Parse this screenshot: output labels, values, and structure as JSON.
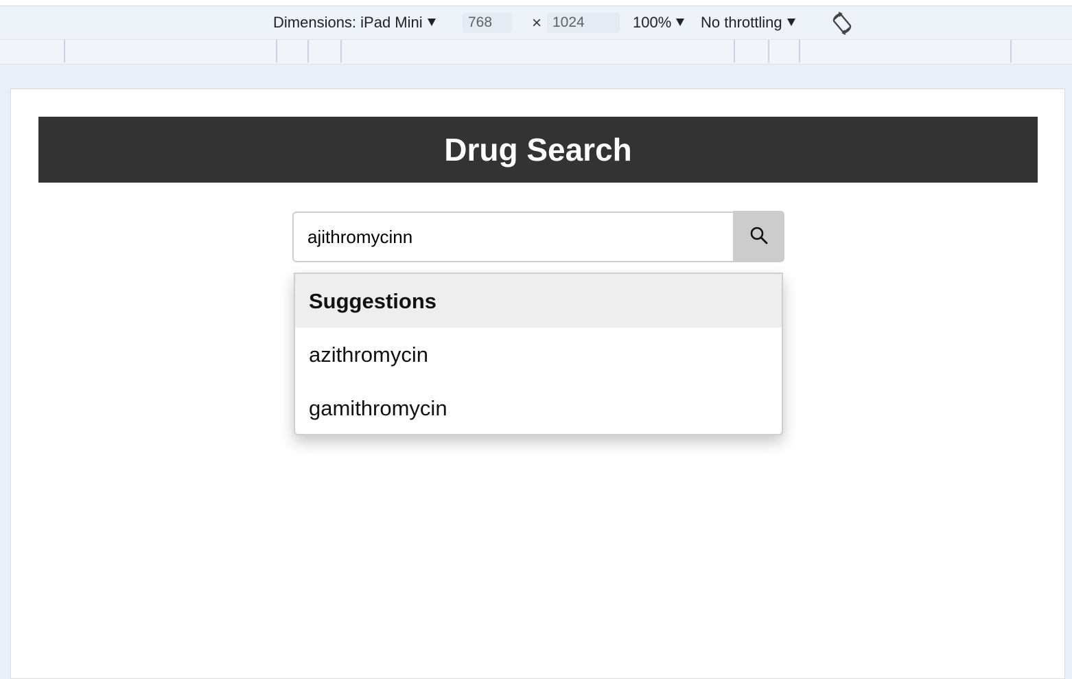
{
  "devtools": {
    "dimensions_label": "Dimensions: iPad Mini",
    "width_value": "768",
    "times": "×",
    "height_value": "1024",
    "zoom": "100%",
    "throttling": "No throttling"
  },
  "app": {
    "title": "Drug Search",
    "search": {
      "value": "ajithromycinn",
      "placeholder": ""
    },
    "suggestions": {
      "header": "Suggestions",
      "items": [
        "azithromycin",
        "gamithromycin"
      ]
    }
  }
}
